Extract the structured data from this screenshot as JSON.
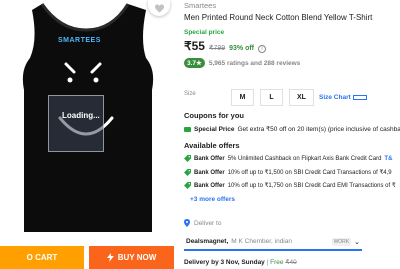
{
  "product": {
    "brand": "Smartees",
    "title": "Men Printed Round Neck Cotton Blend Yellow T-Shirt",
    "image_logo": "SMARTEES",
    "image_loading": "Loading...",
    "special_label": "Special price",
    "price": "₹55",
    "mrp": "₹799",
    "off": "93% off",
    "info_icon": "i",
    "rating": "3.7★",
    "rating_count": "5,965 ratings and 288 reviews"
  },
  "size": {
    "label": "Size",
    "options": [
      "M",
      "L",
      "XL"
    ],
    "chart_link": "Size Chart"
  },
  "coupons": {
    "heading": "Coupons for you",
    "row_bold": "Special Price",
    "row_text": "Get extra ₹50 off on 20 item(s) (price inclusive of cashbac"
  },
  "offers": {
    "heading": "Available offers",
    "items": [
      {
        "bold": "Bank Offer",
        "text": "5% Unlimited Cashback on Flipkart Axis Bank Credit Card",
        "link": "T&"
      },
      {
        "bold": "Bank Offer",
        "text": "10% off up to ₹1,500 on SBI Credit Card Transactions of ₹4,9",
        "link": ""
      },
      {
        "bold": "Bank Offer",
        "text": "10% off up to ₹1,750 on SBI Credit Card EMI Transactions of ₹",
        "link": ""
      }
    ],
    "more": "+3 more offers"
  },
  "delivery": {
    "deliver_to": "Deliver to",
    "name": "Dealsmagnet,",
    "address": "M K Chember, indian",
    "badge": "WORK",
    "delivery_by": "Delivery by 3 Nov, Sunday",
    "separator": "|",
    "free": "Free",
    "strike": "₹40"
  },
  "actions": {
    "add_to_cart": "O CART",
    "buy_now": "BUY NOW"
  },
  "colors": {
    "accent_green": "#388e3c",
    "link_blue": "#2874f0",
    "cart_orange": "#ff9f00",
    "buy_orange": "#fb641b",
    "shirt": "#0c0c0c"
  }
}
